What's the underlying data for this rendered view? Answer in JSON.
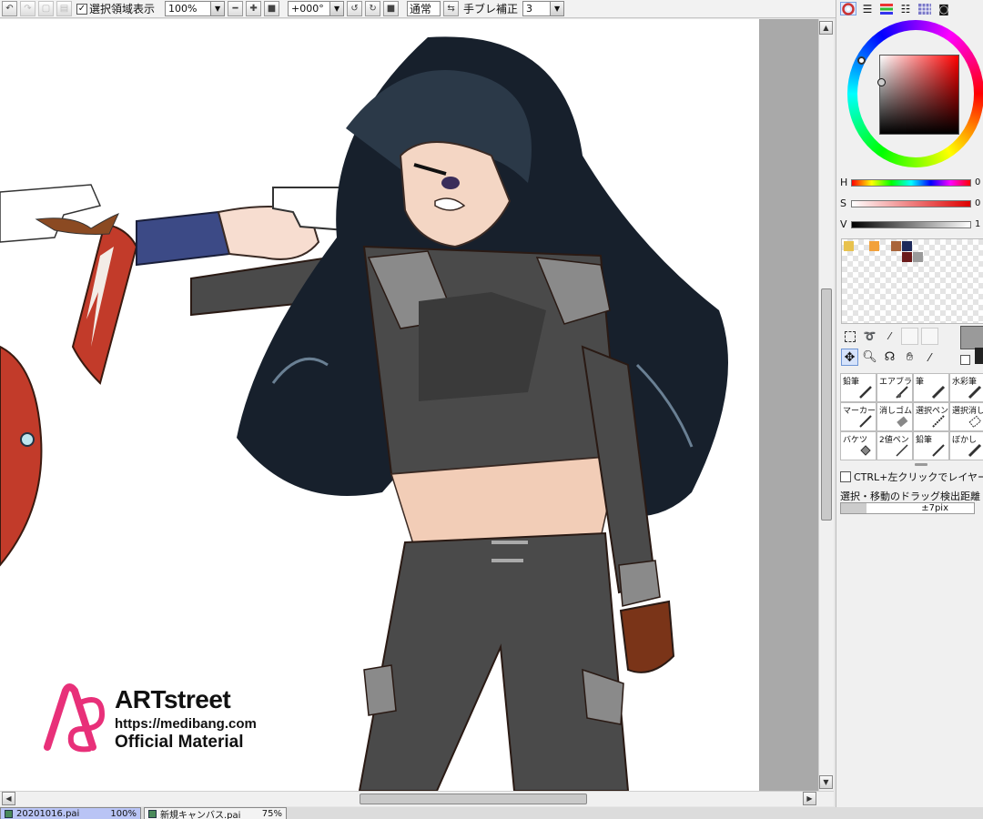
{
  "toolbar": {
    "show_selection_label": "選択領域表示",
    "zoom_value": "100%",
    "rotation_value": "+000°",
    "blend_mode": "通常",
    "stabilizer_label": "手ブレ補正",
    "stabilizer_value": "3"
  },
  "canvas": {
    "watermark": {
      "brand": "ARTstreet",
      "url": "https://medibang.com",
      "subtitle": "Official Material"
    }
  },
  "color_panel": {
    "h_label": "H",
    "s_label": "S",
    "v_label": "V",
    "h_value": "0",
    "s_value": "0",
    "v_value": "1",
    "swatches": [
      "#e8c24e",
      "#f2a13a",
      "#a9643a",
      "#1e2a5a",
      "#6b1a1a",
      "#9a9a9a"
    ]
  },
  "brushes": [
    {
      "label": "鉛筆"
    },
    {
      "label": "エアブラシ"
    },
    {
      "label": "筆"
    },
    {
      "label": "水彩筆"
    },
    {
      "label": "マーカー"
    },
    {
      "label": "消しゴム"
    },
    {
      "label": "選択ペン"
    },
    {
      "label": "選択消し"
    },
    {
      "label": "バケツ"
    },
    {
      "label": "2値ペン"
    },
    {
      "label": "鉛筆"
    },
    {
      "label": "ぼかし"
    }
  ],
  "options": {
    "ctrl_click_label": "CTRL+左クリックでレイヤー選択",
    "drag_distance_label": "選択・移動のドラッグ検出距離",
    "drag_distance_value": "±7pix"
  },
  "tabs": [
    {
      "label": "20201016.pai",
      "zoom": "100%"
    },
    {
      "label": "新規キャンバス.pai",
      "zoom": "75%"
    }
  ]
}
